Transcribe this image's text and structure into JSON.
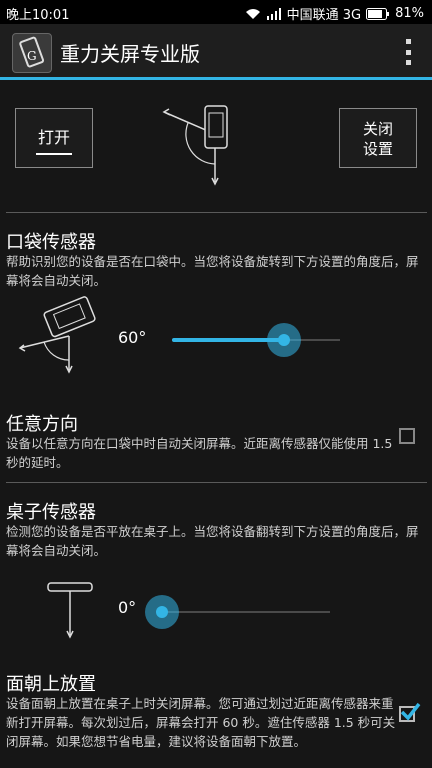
{
  "statusbar": {
    "time": "晚上10:01",
    "carrier": "中国联通 3G",
    "battery": "81%"
  },
  "appbar": {
    "title": "重力关屏专业版"
  },
  "top_buttons": {
    "open_label": "打开",
    "settings_label_line1": "关闭",
    "settings_label_line2": "设置"
  },
  "pocket": {
    "title": "口袋传感器",
    "description": "帮助识别您的设备是否在口袋中。当您将设备旋转到下方设置的角度后，屏幕将会自动关闭。",
    "angle_label": "60°",
    "slider_fraction": 0.67
  },
  "any_direction": {
    "title": "任意方向",
    "description": "设备以任意方向在口袋中时自动关闭屏幕。近距离传感器仅能使用 1.5 秒的延时。",
    "checked": false
  },
  "table": {
    "title": "桌子传感器",
    "description": "检测您的设备是否平放在桌子上。当您将设备翻转到下方设置的角度后，屏幕将会自动关闭。",
    "angle_label": "0°",
    "slider_fraction": 0.0
  },
  "face_up": {
    "title": "面朝上放置",
    "description": "设备面朝上放置在桌子上时关闭屏幕。您可通过划过近距离传感器来重新打开屏幕。每次划过后，屏幕会打开 60 秒。遮住传感器 1.5 秒可关闭屏幕。如果您想节省电量，建议将设备面朝下放置。",
    "checked": true
  },
  "colors": {
    "accent": "#33b5e5",
    "background": "#161616"
  },
  "icons": [
    "wifi-icon",
    "signal-icon",
    "battery-icon",
    "app-icon",
    "overflow-menu-icon",
    "gravity-phone-figure",
    "pocket-phone-figure",
    "table-figure",
    "check-icon"
  ]
}
